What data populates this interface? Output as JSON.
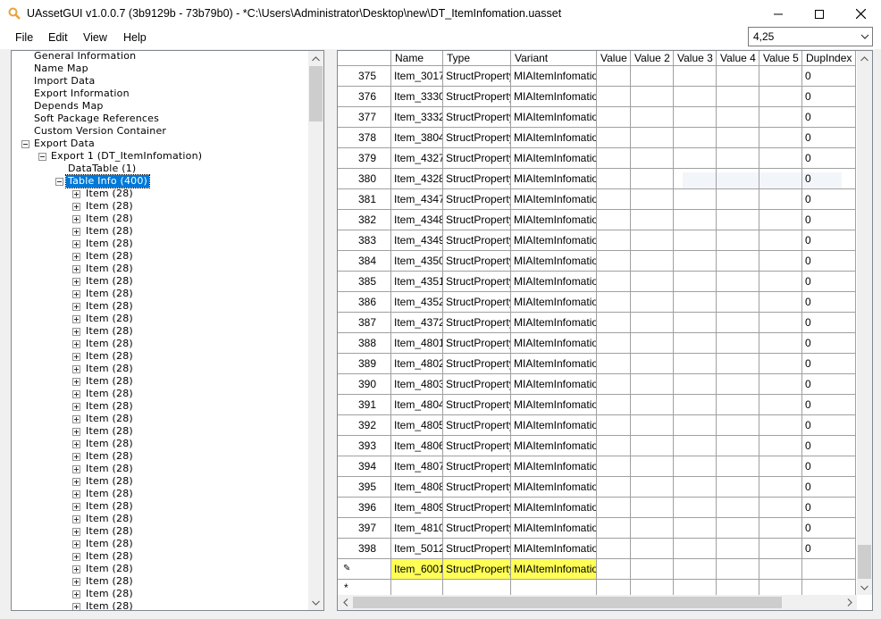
{
  "window": {
    "title": "UAssetGUI v1.0.0.7 (3b9129b - 73b79b0) - *C:\\Users\\Administrator\\Desktop\\new\\DT_ItemInfomation.uasset"
  },
  "menu": [
    "File",
    "Edit",
    "View",
    "Help"
  ],
  "combo": {
    "value": "4,25"
  },
  "tree": {
    "items": [
      {
        "label": "General Information",
        "indent": 0,
        "expander": ""
      },
      {
        "label": "Name Map",
        "indent": 0,
        "expander": ""
      },
      {
        "label": "Import Data",
        "indent": 0,
        "expander": ""
      },
      {
        "label": "Export Information",
        "indent": 0,
        "expander": ""
      },
      {
        "label": "Depends Map",
        "indent": 0,
        "expander": ""
      },
      {
        "label": "Soft Package References",
        "indent": 0,
        "expander": ""
      },
      {
        "label": "Custom Version Container",
        "indent": 0,
        "expander": ""
      },
      {
        "label": "Export Data",
        "indent": 0,
        "expander": "minus"
      },
      {
        "label": "Export 1 (DT_ItemInfomation)",
        "indent": 1,
        "expander": "minus"
      },
      {
        "label": "DataTable (1)",
        "indent": 2,
        "expander": ""
      },
      {
        "label": "Table Info (400)",
        "indent": 2,
        "expander": "minus",
        "selected": true
      }
    ],
    "item_label": "Item (28)",
    "item_count": 34
  },
  "grid": {
    "columns": [
      "",
      "Name",
      "Type",
      "Variant",
      "Value",
      "Value 2",
      "Value 3",
      "Value 4",
      "Value 5",
      "DupIndex"
    ],
    "rows": [
      {
        "num": "375",
        "name": "Item_3017",
        "type": "StructProperty",
        "variant": "MIAItemInfomation",
        "dup": "0"
      },
      {
        "num": "376",
        "name": "Item_3330",
        "type": "StructProperty",
        "variant": "MIAItemInfomation",
        "dup": "0"
      },
      {
        "num": "377",
        "name": "Item_3332",
        "type": "StructProperty",
        "variant": "MIAItemInfomation",
        "dup": "0"
      },
      {
        "num": "378",
        "name": "Item_3804",
        "type": "StructProperty",
        "variant": "MIAItemInfomation",
        "dup": "0"
      },
      {
        "num": "379",
        "name": "Item_4327",
        "type": "StructProperty",
        "variant": "MIAItemInfomation",
        "dup": "0"
      },
      {
        "num": "380",
        "name": "Item_4328",
        "type": "StructProperty",
        "variant": "MIAItemInfomation",
        "dup": "0"
      },
      {
        "num": "381",
        "name": "Item_4347",
        "type": "StructProperty",
        "variant": "MIAItemInfomation",
        "dup": "0"
      },
      {
        "num": "382",
        "name": "Item_4348",
        "type": "StructProperty",
        "variant": "MIAItemInfomation",
        "dup": "0"
      },
      {
        "num": "383",
        "name": "Item_4349",
        "type": "StructProperty",
        "variant": "MIAItemInfomation",
        "dup": "0"
      },
      {
        "num": "384",
        "name": "Item_4350",
        "type": "StructProperty",
        "variant": "MIAItemInfomation",
        "dup": "0"
      },
      {
        "num": "385",
        "name": "Item_4351",
        "type": "StructProperty",
        "variant": "MIAItemInfomation",
        "dup": "0"
      },
      {
        "num": "386",
        "name": "Item_4352",
        "type": "StructProperty",
        "variant": "MIAItemInfomation",
        "dup": "0"
      },
      {
        "num": "387",
        "name": "Item_4372",
        "type": "StructProperty",
        "variant": "MIAItemInfomation",
        "dup": "0"
      },
      {
        "num": "388",
        "name": "Item_4801",
        "type": "StructProperty",
        "variant": "MIAItemInfomation",
        "dup": "0"
      },
      {
        "num": "389",
        "name": "Item_4802",
        "type": "StructProperty",
        "variant": "MIAItemInfomation",
        "dup": "0"
      },
      {
        "num": "390",
        "name": "Item_4803",
        "type": "StructProperty",
        "variant": "MIAItemInfomation",
        "dup": "0"
      },
      {
        "num": "391",
        "name": "Item_4804",
        "type": "StructProperty",
        "variant": "MIAItemInfomation",
        "dup": "0"
      },
      {
        "num": "392",
        "name": "Item_4805",
        "type": "StructProperty",
        "variant": "MIAItemInfomation",
        "dup": "0"
      },
      {
        "num": "393",
        "name": "Item_4806",
        "type": "StructProperty",
        "variant": "MIAItemInfomation",
        "dup": "0"
      },
      {
        "num": "394",
        "name": "Item_4807",
        "type": "StructProperty",
        "variant": "MIAItemInfomation",
        "dup": "0"
      },
      {
        "num": "395",
        "name": "Item_4808",
        "type": "StructProperty",
        "variant": "MIAItemInfomation",
        "dup": "0"
      },
      {
        "num": "396",
        "name": "Item_4809",
        "type": "StructProperty",
        "variant": "MIAItemInfomation",
        "dup": "0"
      },
      {
        "num": "397",
        "name": "Item_4810",
        "type": "StructProperty",
        "variant": "MIAItemInfomation",
        "dup": "0"
      },
      {
        "num": "398",
        "name": "Item_5012",
        "type": "StructProperty",
        "variant": "MIAItemInfomation",
        "dup": "0"
      }
    ],
    "edit_row": {
      "name": "Item_6001",
      "type": "StructProperty",
      "variant": "MIAItemInfomation",
      "marker": "✎"
    },
    "new_row_marker": "*"
  },
  "colors": {
    "selection": "#0078d7",
    "highlight": "#ffff55",
    "app_icon": "#e8a33a"
  }
}
